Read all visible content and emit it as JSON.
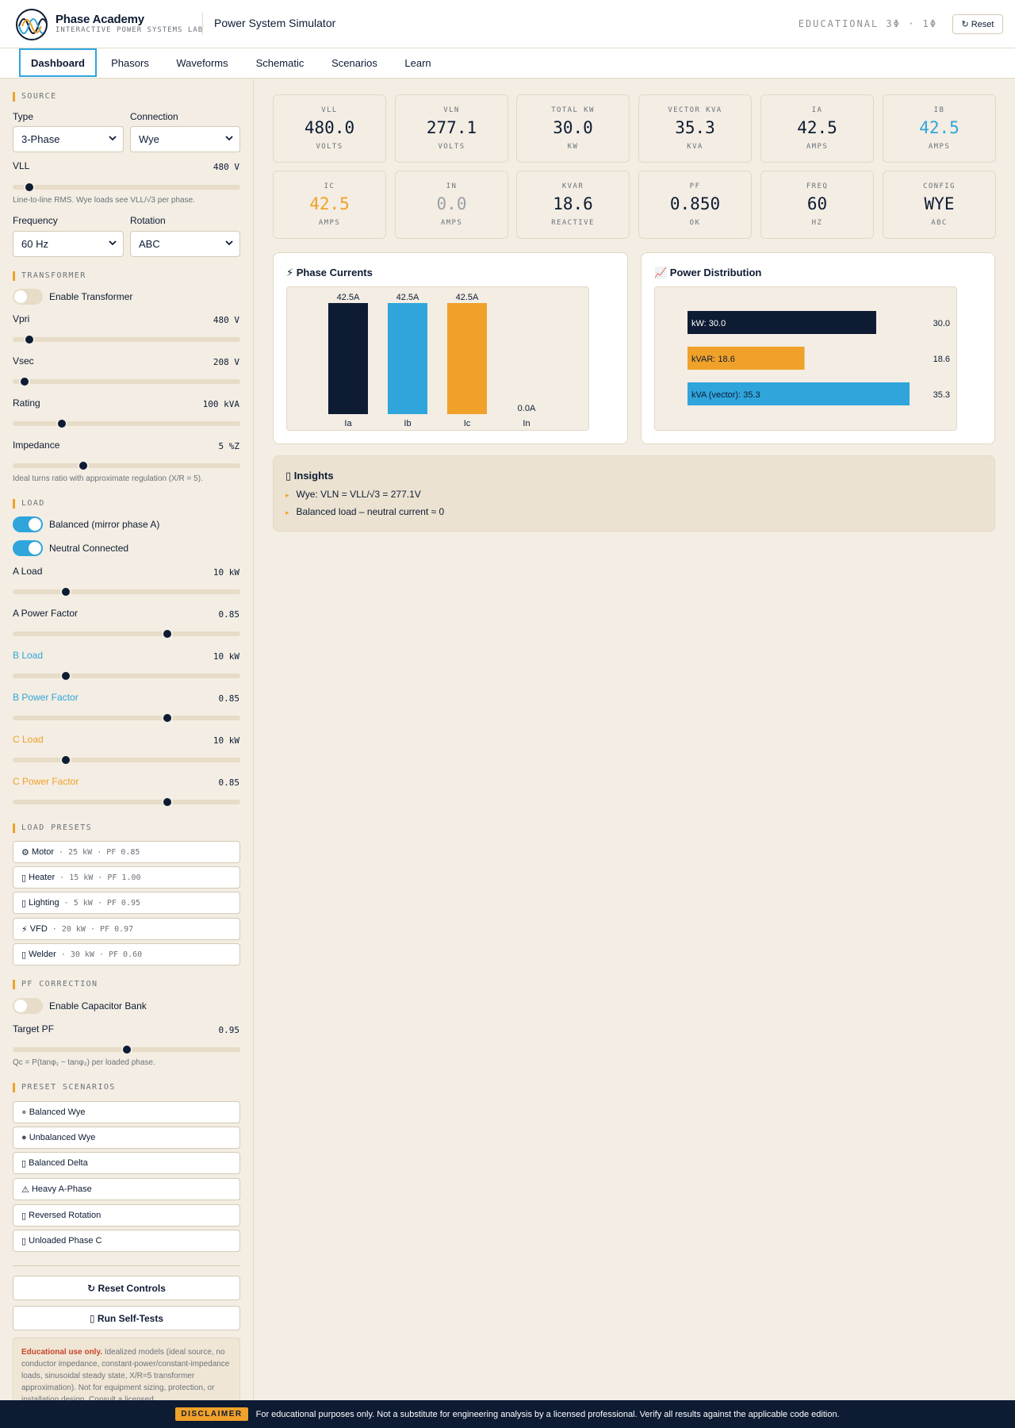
{
  "header": {
    "brand_name": "Phase Academy",
    "brand_sub": "INTERACTIVE POWER SYSTEMS LAB",
    "app_title": "Power System Simulator",
    "edu_tag": "EDUCATIONAL 3Φ · 1Φ",
    "reset_label": "Reset",
    "reset_icon": "↻"
  },
  "tabs": [
    "Dashboard",
    "Phasors",
    "Waveforms",
    "Schematic",
    "Scenarios",
    "Learn"
  ],
  "sidebar": {
    "source": {
      "head": "SOURCE",
      "type_label": "Type",
      "type_value": "3-Phase",
      "connection_label": "Connection",
      "connection_value": "Wye",
      "vll_label": "VLL",
      "vll_value": "480 V",
      "vll_level": 0.05,
      "vll_note": "Line-to-line RMS. Wye loads see VLL/√3 per phase.",
      "freq_label": "Frequency",
      "freq_value": "60 Hz",
      "rotation_label": "Rotation",
      "rotation_value": "ABC"
    },
    "transformer": {
      "head": "TRANSFORMER",
      "enable_label": "Enable Transformer",
      "enabled": false,
      "vpri_label": "Vpri",
      "vpri_value": "480 V",
      "vpri_level": 0.05,
      "vsec_label": "Vsec",
      "vsec_value": "208 V",
      "vsec_level": 0.03,
      "rating_label": "Rating",
      "rating_value": "100 kVA",
      "rating_level": 0.2,
      "imp_label": "Impedance",
      "imp_value": "5 %Z",
      "imp_level": 0.3,
      "note": "Ideal turns ratio with approximate regulation (X/R = 5)."
    },
    "load": {
      "head": "LOAD",
      "balanced_label": "Balanced (mirror phase A)",
      "balanced": true,
      "neutral_label": "Neutral Connected",
      "neutral": true,
      "a_load_label": "A Load",
      "a_load_value": "10 kW",
      "a_load_level": 0.22,
      "a_pf_label": "A Power Factor",
      "a_pf_value": "0.85",
      "a_pf_level": 0.69,
      "b_load_label": "B Load",
      "b_load_value": "10 kW",
      "b_load_level": 0.22,
      "b_pf_label": "B Power Factor",
      "b_pf_value": "0.85",
      "b_pf_level": 0.69,
      "c_load_label": "C Load",
      "c_load_value": "10 kW",
      "c_load_level": 0.22,
      "c_pf_label": "C Power Factor",
      "c_pf_value": "0.85",
      "c_pf_level": 0.69
    },
    "presets": {
      "head": "LOAD PRESETS",
      "items": [
        {
          "icon": "⚙",
          "name": "Motor",
          "meta": "· 25 kW · PF 0.85"
        },
        {
          "icon": "▯",
          "name": "Heater",
          "meta": "· 15 kW · PF 1.00"
        },
        {
          "icon": "▯",
          "name": "Lighting",
          "meta": "· 5 kW · PF 0.95"
        },
        {
          "icon": "⚡",
          "name": "VFD",
          "meta": "· 20 kW · PF 0.97"
        },
        {
          "icon": "▯",
          "name": "Welder",
          "meta": "· 30 kW · PF 0.60"
        }
      ]
    },
    "pf_correction": {
      "head": "PF CORRECTION",
      "enable_label": "Enable Capacitor Bank",
      "enabled": false,
      "target_label": "Target PF",
      "target_value": "0.95",
      "target_level": 0.5,
      "note": "Qc = P(tanφ₁ − tanφ₂) per loaded phase."
    },
    "scenarios": {
      "head": "PRESET SCENARIOS",
      "items": [
        {
          "icon": "●",
          "name": "Balanced Wye"
        },
        {
          "icon": "●",
          "name": "Unbalanced Wye"
        },
        {
          "icon": "▯",
          "name": "Balanced Delta"
        },
        {
          "icon": "⚠",
          "name": "Heavy A-Phase"
        },
        {
          "icon": "▯",
          "name": "Reversed Rotation"
        },
        {
          "icon": "▯",
          "name": "Unloaded Phase C"
        }
      ]
    },
    "reset_controls": "↻ Reset Controls",
    "self_tests": "▯ Run Self-Tests",
    "disclaimer_bold": "Educational use only.",
    "disclaimer_text": "Idealized models (ideal source, no conductor impedance, constant-power/constant-impedance loads, sinusoidal steady state, X/R=5 transformer approximation). Not for equipment sizing, protection, or installation design. Consult a licensed"
  },
  "metrics": [
    {
      "key": "VLL",
      "value": "480.0",
      "unit": "VOLTS",
      "color": "#0d1b33"
    },
    {
      "key": "VLN",
      "value": "277.1",
      "unit": "VOLTS",
      "color": "#0d1b33"
    },
    {
      "key": "TOTAL KW",
      "value": "30.0",
      "unit": "KW",
      "color": "#0d1b33"
    },
    {
      "key": "VECTOR KVA",
      "value": "35.3",
      "unit": "KVA",
      "color": "#0d1b33"
    },
    {
      "key": "IA",
      "value": "42.5",
      "unit": "AMPS",
      "color": "#0d1b33"
    },
    {
      "key": "IB",
      "value": "42.5",
      "unit": "AMPS",
      "color": "#2fa5dc"
    },
    {
      "key": "IC",
      "value": "42.5",
      "unit": "AMPS",
      "color": "#f0a12a"
    },
    {
      "key": "IN",
      "value": "0.0",
      "unit": "AMPS",
      "color": "#9ba0a6"
    },
    {
      "key": "KVAR",
      "value": "18.6",
      "unit": "REACTIVE",
      "color": "#0d1b33"
    },
    {
      "key": "PF",
      "value": "0.850",
      "unit": "OK",
      "color": "#0d1b33"
    },
    {
      "key": "FREQ",
      "value": "60",
      "unit": "HZ",
      "color": "#0d1b33"
    },
    {
      "key": "CONFIG",
      "value": "WYE",
      "unit": "ABC",
      "color": "#0d1b33"
    }
  ],
  "phase_currents_title": "⚡ Phase Currents",
  "power_dist_title": "📈 Power Distribution",
  "chart_data": [
    {
      "type": "bar",
      "categories": [
        "Ia",
        "Ib",
        "Ic",
        "In"
      ],
      "values": [
        42.5,
        42.5,
        42.5,
        0.0
      ],
      "data_labels": [
        "42.5A",
        "42.5A",
        "42.5A",
        "0.0A"
      ],
      "colors": [
        "#0d1b33",
        "#2fa5dc",
        "#f0a12a",
        "#9ba0a6"
      ],
      "title": "",
      "ylim": [
        0,
        42.5
      ]
    },
    {
      "type": "bar",
      "orientation": "horizontal",
      "categories": [
        "kW: 30.0",
        "kVAR: 18.6",
        "kVA (vector): 35.3"
      ],
      "values": [
        30.0,
        18.6,
        35.3
      ],
      "data_labels": [
        "30.0",
        "18.6",
        "35.3"
      ],
      "colors": [
        "#0d1b33",
        "#f0a12a",
        "#2fa5dc"
      ],
      "title": "",
      "xlim": [
        0,
        35.3
      ]
    }
  ],
  "insights": {
    "title": "▯ Insights",
    "items": [
      "Wye: VLN = VLL/√3 = 277.1V",
      "Balanced load – neutral current ≈ 0"
    ]
  },
  "footer": {
    "badge": "DISCLAIMER",
    "text": "For educational purposes only. Not a substitute for engineering analysis by a licensed professional. Verify all results against the applicable code edition."
  }
}
